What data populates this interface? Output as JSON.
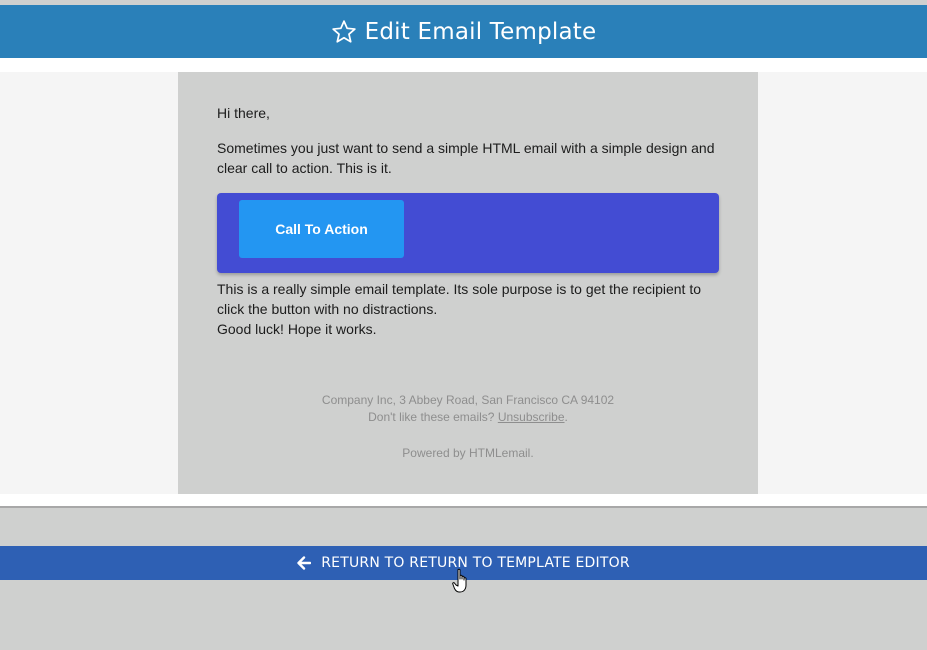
{
  "header": {
    "title": "Edit Email Template",
    "icon": "star-outline-icon",
    "color": "#2a80b9"
  },
  "email": {
    "greeting": "Hi there,",
    "intro": "Sometimes you just want to send a simple HTML email with a simple design and clear call to action. This is it.",
    "cta_label": "Call To Action",
    "cta_box_color": "#434cd3",
    "cta_button_color": "#2396f2",
    "body_line1": "This is a really simple email template. Its sole purpose is to get the recipient to click the button with no distractions.",
    "body_line2": "Good luck! Hope it works.",
    "footer": {
      "address": "Company Inc, 3 Abbey Road, San Francisco CA 94102",
      "unsub_prefix": "Don't like these emails? ",
      "unsub_link": "Unsubscribe",
      "unsub_suffix": ".",
      "powered": "Powered by HTMLemail."
    }
  },
  "return_bar": {
    "label": "RETURN TO RETURN TO TEMPLATE EDITOR",
    "icon": "arrow-left-icon",
    "color": "#2e60b4"
  }
}
